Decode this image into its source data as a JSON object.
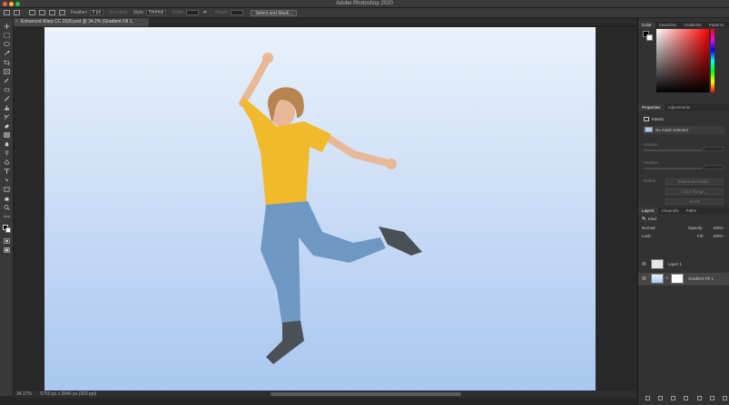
{
  "window": {
    "title": "Adobe Photoshop 2020"
  },
  "options_bar": {
    "feather_label": "Feather:",
    "feather_value": "0 px",
    "antialias_label": "Anti-alias",
    "style_label": "Style:",
    "style_value": "Normal",
    "width_label": "Width:",
    "height_label": "Height:",
    "select_mask_button": "Select and Mask..."
  },
  "document_tab": {
    "title": "Enhanced Warp CC 2020.psd @ 34.2% (Gradient Fill 1, RGB/8) *"
  },
  "status": {
    "zoom": "34.17%",
    "dimensions": "5760 px x 3840 px (300 ppi)"
  },
  "panels": {
    "color_tabs": [
      "Color",
      "Swatches",
      "Gradients",
      "Patterns"
    ],
    "properties_tabs": [
      "Properties",
      "Adjustments"
    ],
    "properties": {
      "masks_label": "Masks",
      "no_mask": "No mask selected",
      "density_label": "Density:",
      "feather_label": "Feather:",
      "refine_label": "Refine:",
      "select_mask_button": "Select and Mask...",
      "color_range_button": "Color Range...",
      "invert_button": "Invert"
    },
    "layers_tabs": [
      "Layers",
      "Channels",
      "Paths"
    ],
    "layers": {
      "kind_label": "Kind",
      "blend_mode": "Normal",
      "opacity_label": "Opacity:",
      "opacity_value": "100%",
      "lock_label": "Lock:",
      "fill_label": "Fill:",
      "fill_value": "100%",
      "items": [
        {
          "name": "Layer 1",
          "selected": false
        },
        {
          "name": "Gradient Fill 1",
          "selected": true
        }
      ]
    }
  },
  "colors": {
    "canvas_top": "#eaf2fc",
    "canvas_bottom": "#a9c7f0",
    "shirt": "#f1b92c",
    "jeans": "#6f97c3",
    "skin": "#e9b896",
    "hair": "#b78350"
  }
}
